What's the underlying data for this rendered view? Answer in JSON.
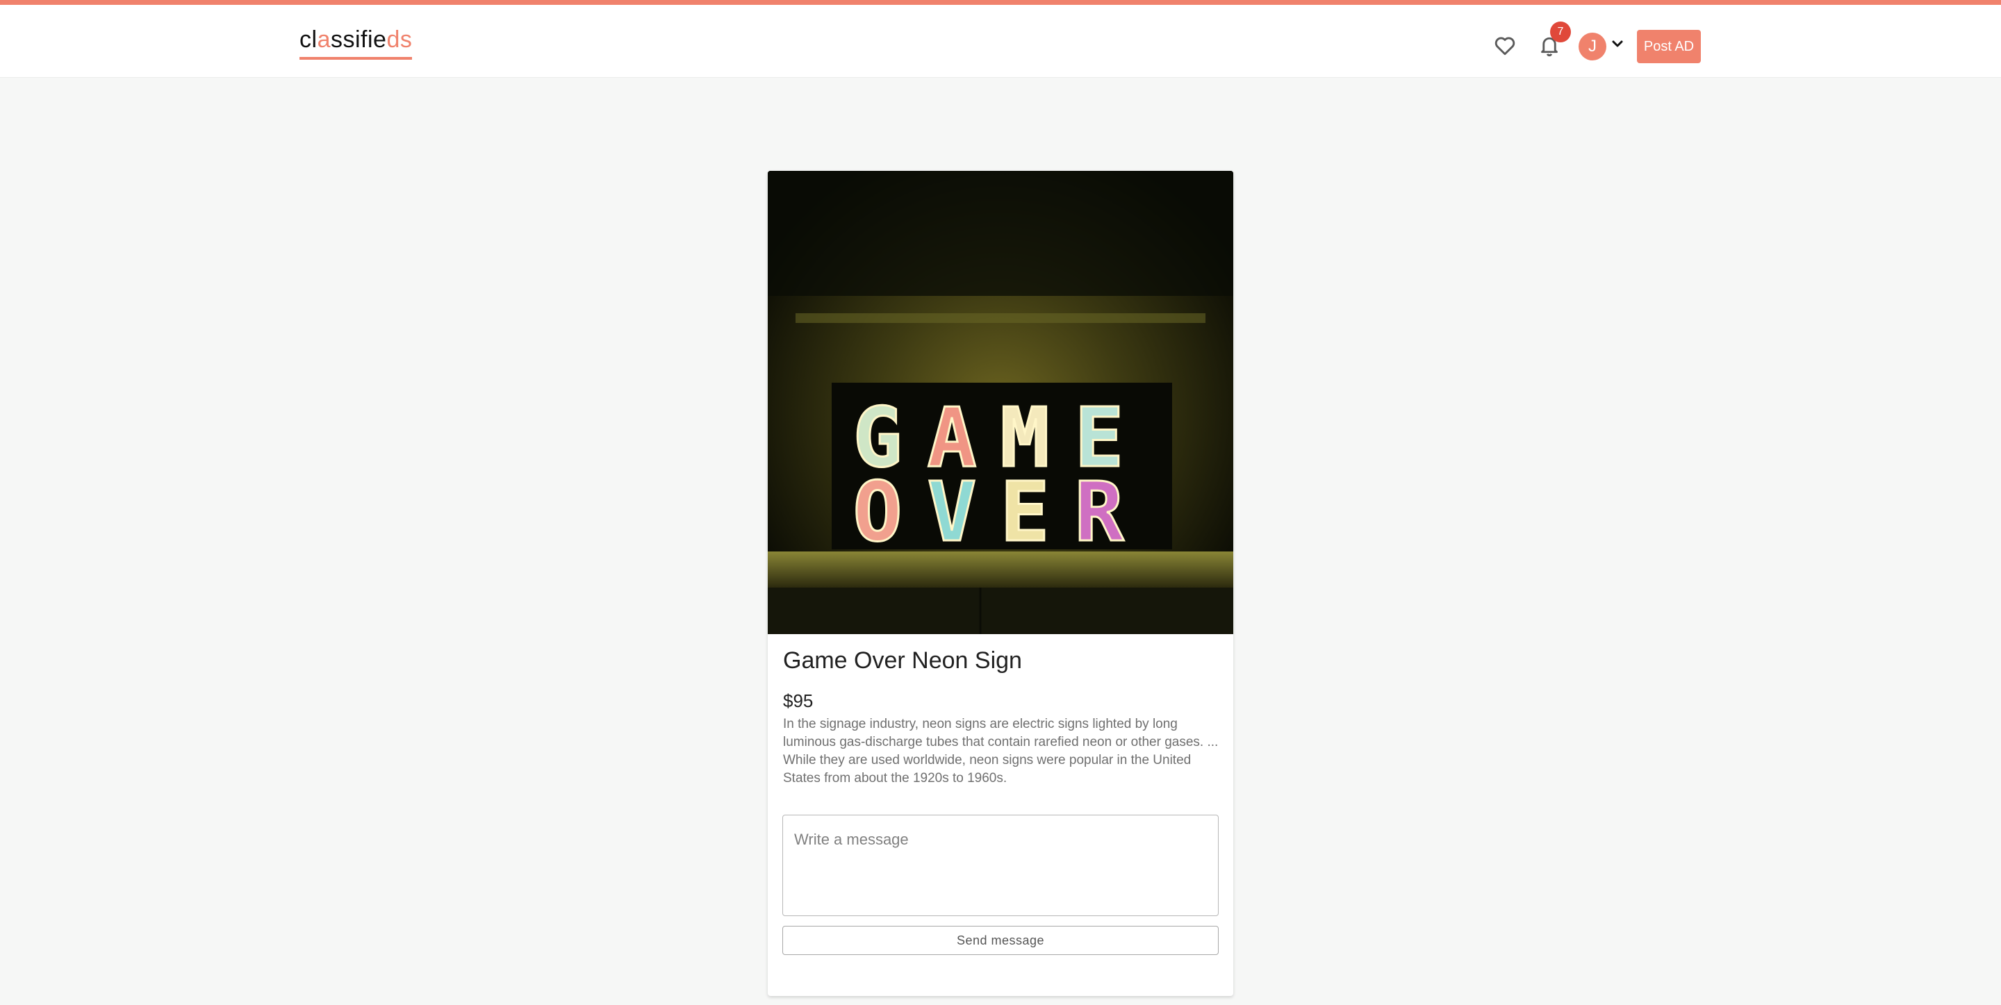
{
  "app": {
    "logo_parts": [
      "cl",
      "a",
      "ssifie",
      "ds"
    ],
    "accent_color": "#f0826c"
  },
  "header": {
    "favorites_icon": "heart-icon",
    "notifications_icon": "bell-icon",
    "notification_count": "7",
    "user_initial": "J",
    "user_menu_icon": "chevron-down-icon",
    "post_button_label": "Post AD"
  },
  "listing": {
    "image_alt_text": [
      "GAME",
      "OVER"
    ],
    "title": "Game Over Neon Sign",
    "price": "$95",
    "description": "In the signage industry, neon signs are electric signs lighted by long luminous gas-discharge tubes that contain rarefied neon or other gases. ... While they are used worldwide, neon signs were popular in the United States from about the 1920s to 1960s."
  },
  "contact": {
    "message_placeholder": "Write a message",
    "send_button_label": "Send message"
  }
}
